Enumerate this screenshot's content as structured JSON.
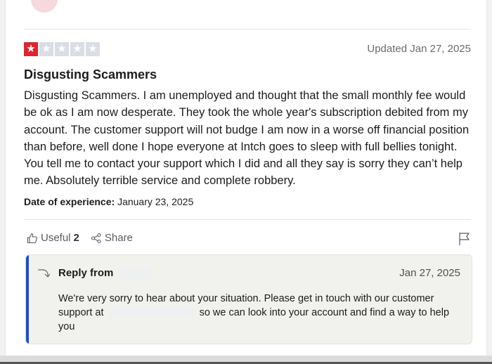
{
  "review": {
    "rating": 1,
    "max_rating": 5,
    "updated": "Updated Jan 27, 2025",
    "title": "Disgusting Scammers",
    "body": "Disgusting Scammers. I am unemployed and thought that the small monthly fee would be ok as I am now desperate. They took the whole year's subscription debited from my account. The customer support will not budge I am now in a worse off financial position than before, well done I hope everyone at Intch goes to sleep with full bellies tonight. You tell me to contact your support which I did and all they say is sorry they can’t help me. Absolutely terrible service and complete robbery.",
    "date_label": "Date of experience:",
    "date_value": "January 23, 2025"
  },
  "actions": {
    "useful_label": "Useful",
    "useful_count": "2",
    "share_label": "Share"
  },
  "reply": {
    "from_label": "Reply from",
    "date": "Jan 27, 2025",
    "text_part1": "We're very sorry to hear about your situation. Please get in touch with our customer support at",
    "text_part2": "so we can look into your account and find a way to help you"
  },
  "colors": {
    "star_filled": "#e0242e",
    "star_empty": "#dcdce6",
    "reply_accent": "#1450d3"
  },
  "icons": [
    "star-icon",
    "thumbs-up-icon",
    "share-icon",
    "flag-icon",
    "reply-arrow-icon"
  ]
}
